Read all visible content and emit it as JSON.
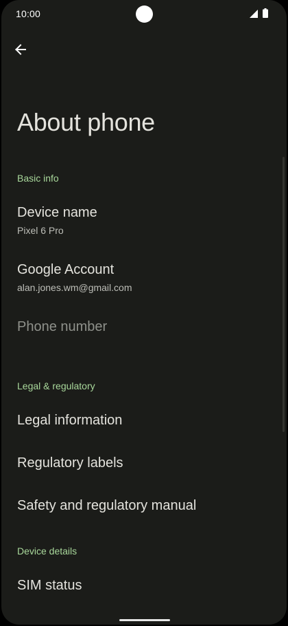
{
  "status_bar": {
    "time": "10:00",
    "icons": [
      "signal-icon",
      "battery-icon"
    ]
  },
  "toolbar": {
    "back_icon": "arrow-back-icon"
  },
  "page": {
    "title": "About phone"
  },
  "sections": {
    "basic_info": {
      "header": "Basic info",
      "device_name": {
        "title": "Device name",
        "summary": "Pixel 6 Pro"
      },
      "google_account": {
        "title": "Google Account",
        "summary": "alan.jones.wm@gmail.com"
      },
      "phone_number": {
        "title": "Phone number"
      }
    },
    "legal": {
      "header": "Legal & regulatory",
      "legal_information": {
        "title": "Legal information"
      },
      "regulatory_labels": {
        "title": "Regulatory labels"
      },
      "safety_manual": {
        "title": "Safety and regulatory manual"
      }
    },
    "device_details": {
      "header": "Device details",
      "sim_status": {
        "title": "SIM status"
      }
    }
  },
  "colors": {
    "background": "#1b1c19",
    "accent_green": "#a9d89b",
    "primary_text": "#e4e3dd",
    "secondary_text": "#bdbeb8",
    "disabled_text": "#8f918b"
  }
}
